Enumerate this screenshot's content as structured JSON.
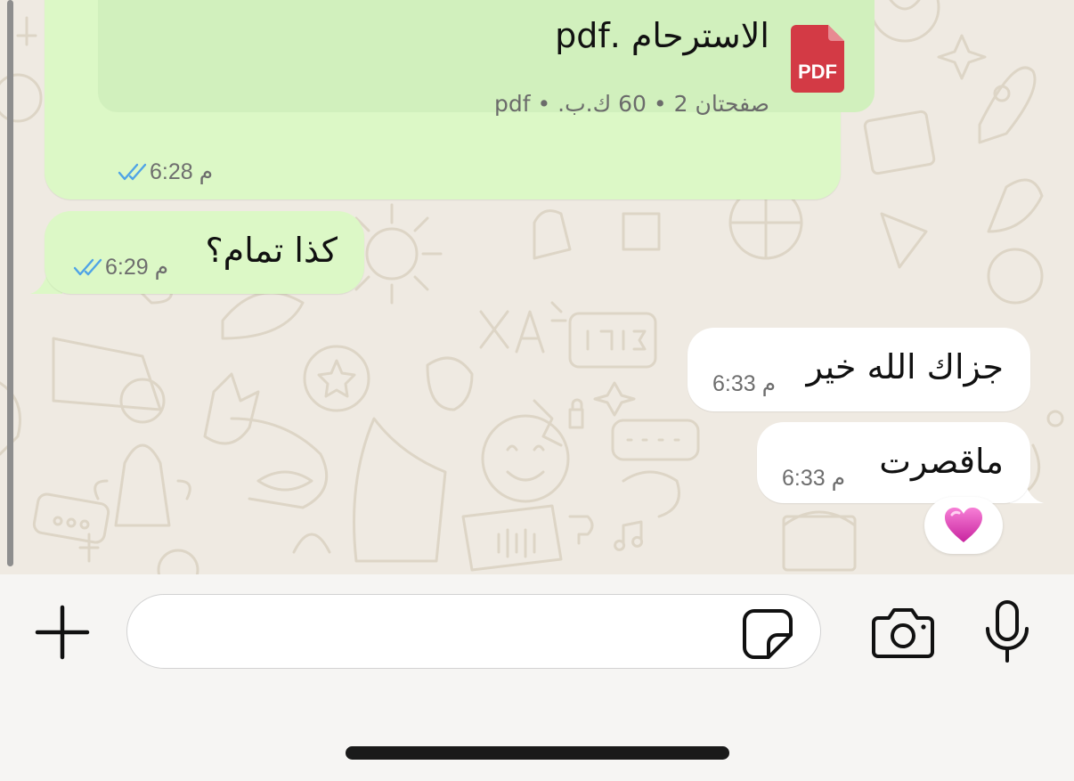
{
  "colors": {
    "outgoing_bubble": "#dcf8c6",
    "incoming_bubble": "#ffffff",
    "read_ticks": "#4fa3e6",
    "pdf_badge": "#d33a45",
    "chat_background": "#efeae2"
  },
  "messages": [
    {
      "direction": "outgoing",
      "kind": "document",
      "file_name": "الاسترحام .pdf",
      "file_meta": "صفحتان 2 • 60 ك.ب. • pdf",
      "file_icon": "PDF",
      "time": "6:28 م",
      "status": "read"
    },
    {
      "direction": "outgoing",
      "kind": "text",
      "text": "كذا تمام؟",
      "time": "6:29 م",
      "status": "read"
    },
    {
      "direction": "incoming",
      "kind": "text",
      "text": "جزاك الله خير",
      "time": "6:33 م"
    },
    {
      "direction": "incoming",
      "kind": "text",
      "text": "ماقصرت",
      "time": "6:33 م",
      "reaction": "💗"
    }
  ],
  "composer": {
    "text": "",
    "attach_icon": "plus-icon",
    "sticker_icon": "sticker-icon",
    "camera_icon": "camera-icon",
    "mic_icon": "microphone-icon"
  }
}
